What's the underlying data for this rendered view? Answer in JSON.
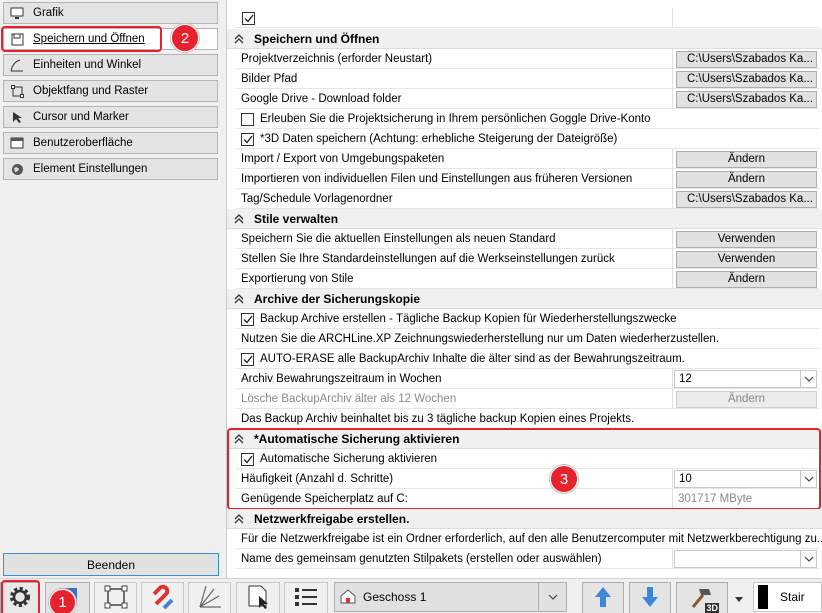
{
  "sidebar": {
    "items": [
      {
        "label": "Grafik",
        "icon": "monitor-icon"
      },
      {
        "label": "Speichern und Öffnen",
        "icon": "save-icon"
      },
      {
        "label": "Einheiten und Winkel",
        "icon": "angle-icon"
      },
      {
        "label": "Objektfang und Raster",
        "icon": "snap-grid-icon"
      },
      {
        "label": "Cursor und Marker",
        "icon": "cursor-icon"
      },
      {
        "label": "Benutzeroberfläche",
        "icon": "ui-icon"
      },
      {
        "label": "Element Einstellungen",
        "icon": "globe-icon"
      }
    ],
    "close_label": "Beenden"
  },
  "annotations": {
    "badge1": "1",
    "badge2": "2",
    "badge3": "3"
  },
  "sections": {
    "save": {
      "title": "Speichern und Öffnen",
      "project_dir": {
        "label": "Projektverzeichnis (erforder Neustart)",
        "value": "C:\\Users\\Szabados Ka..."
      },
      "images_path": {
        "label": "Bilder Pfad",
        "value": "C:\\Users\\Szabados Ka..."
      },
      "gdrive": {
        "label": "Google Drive - Download folder",
        "value": "C:\\Users\\Szabados Ka..."
      },
      "gdrive_allow": {
        "label": "Erleuben Sie die Projektsicherung in Ihrem persönlichen Goggle Drive-Konto",
        "checked": false
      },
      "save3d": {
        "label": "*3D Daten speichern (Achtung: erhebliche Steigerung der Dateigröße)",
        "checked": true
      },
      "import_export": {
        "label": "Import / Export von Umgebungspaketen",
        "button": "Ändern"
      },
      "import_old": {
        "label": "Importieren von individuellen Filen und Einstellungen aus früheren Versionen",
        "button": "Ändern"
      },
      "tag_schedule": {
        "label": "Tag/Schedule Vorlagenordner",
        "value": "C:\\Users\\Szabados Ka..."
      }
    },
    "styles": {
      "title": "Stile verwalten",
      "save_default": {
        "label": "Speichern Sie die aktuellen Einstellungen als neuen Standard",
        "button": "Verwenden"
      },
      "reset_default": {
        "label": "Stellen Sie Ihre Standardeinstellungen auf die Werkseinstellungen zurück",
        "button": "Verwenden"
      },
      "export": {
        "label": "Exportierung von Stile",
        "button": "Ändern"
      }
    },
    "archive": {
      "title": "Archive der Sicherungskopie",
      "create": {
        "label": "Backup Archive erstellen - Tägliche Backup Kopien für Wiederherstellungszwecke",
        "checked": true
      },
      "info": "Nutzen Sie die ARCHLine.XP Zeichnungswiederherstellung nur um Daten wiederherzustellen.",
      "auto_erase": {
        "label": "AUTO-ERASE alle BackupArchiv Inhalte die älter sind as der Bewahrungszeitraum.",
        "checked": true
      },
      "retention": {
        "label": "Archiv Bewahrungszeitraum in Wochen",
        "value": "12"
      },
      "delete_old": {
        "label": "Lösche BackupArchiv älter als 12 Wochen",
        "button": "Ändern"
      },
      "note": "Das Backup Archiv beinhaltet bis zu 3 tägliche backup Kopien eines Projekts."
    },
    "autosave": {
      "title": "*Automatische Sicherung aktivieren",
      "enable": {
        "label": "Automatische Sicherung aktivieren",
        "checked": true
      },
      "frequency": {
        "label": "Häufigkeit (Anzahl d. Schritte)",
        "value": "10"
      },
      "space": {
        "label": "Genügende Speicherplatz auf C:",
        "value": "301717 MByte"
      }
    },
    "network": {
      "title": "Netzwerkfreigabe erstellen.",
      "info": "Für die Netzwerkfreigabe ist ein Ordner erforderlich, auf den alle Benutzercomputer mit Netzwerkberechtigung zu...",
      "package": {
        "label": "Name des gemeinsam genutzten Stilpakets (erstellen oder auswählen)",
        "value": ""
      }
    }
  },
  "toolbar": {
    "floor_label": "Geschoss 1",
    "stair_label": "Stair",
    "zoom_label": "3D"
  },
  "colors": {
    "highlight": "#e8212f",
    "accent_blue": "#3c8fd8"
  }
}
